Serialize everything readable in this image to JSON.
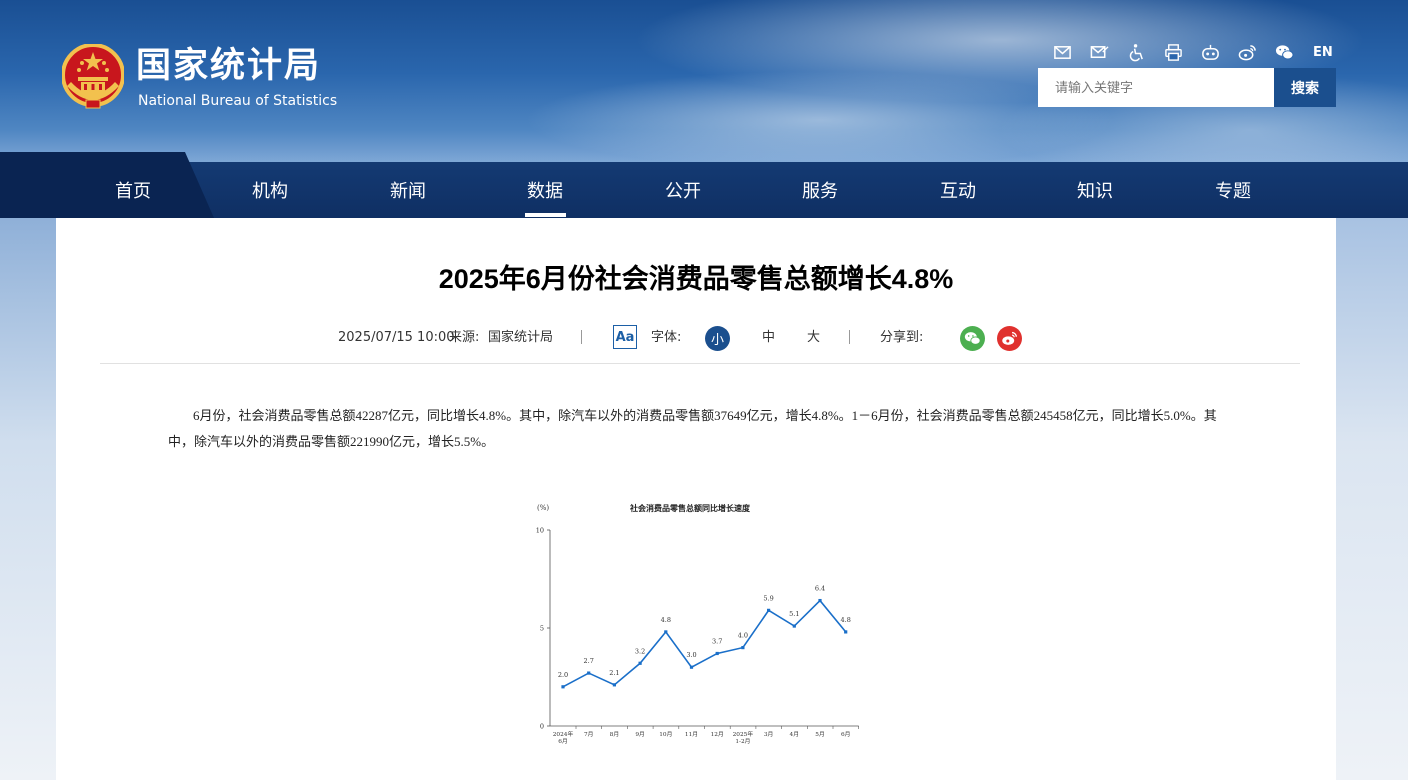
{
  "header": {
    "logo_cn": "国家统计局",
    "logo_en": "National Bureau of Statistics",
    "tool_icons": [
      "mail-icon",
      "mail-edit-icon",
      "accessibility-icon",
      "print-icon",
      "robot-icon",
      "weibo-icon",
      "wechat-icon"
    ],
    "lang": "EN",
    "search": {
      "placeholder": "请输入关键字",
      "button": "搜索"
    }
  },
  "nav": {
    "items": [
      "首页",
      "机构",
      "新闻",
      "数据",
      "公开",
      "服务",
      "互动",
      "知识",
      "专题"
    ],
    "active": "数据"
  },
  "article": {
    "title": "2025年6月份社会消费品零售总额增长4.8%",
    "date": "2025/07/15 10:00",
    "source_label": "来源:",
    "source": "国家统计局",
    "font_icon": "Aa",
    "font_label": "字体:",
    "sizes": [
      "小",
      "中",
      "大"
    ],
    "share_label": "分享到:",
    "body": "6月份，社会消费品零售总额42287亿元，同比增长4.8%。其中，除汽车以外的消费品零售额37649亿元，增长4.8%。1－6月份，社会消费品零售总额245458亿元，同比增长5.0%。其中，除汽车以外的消费品零售额221990亿元，增长5.5%。"
  },
  "colors": {
    "nav_bg": "#0f2f63",
    "accent": "#1b4f8e",
    "line": "#1a6fc9",
    "wechat": "#4caf50",
    "weibo": "#e0312e"
  },
  "chart_data": {
    "type": "line",
    "title": "社会消费品零售总额同比增长速度",
    "ylabel": "(%)",
    "ylim": [
      0,
      10
    ],
    "yticks": [
      "0",
      "5",
      "10"
    ],
    "categories": [
      "2024年6月",
      "7月",
      "8月",
      "9月",
      "10月",
      "11月",
      "12月",
      "2025年1-2月",
      "3月",
      "4月",
      "5月",
      "6月"
    ],
    "x_tick_lines": [
      [
        "2024年",
        "6月"
      ],
      [
        "7月"
      ],
      [
        "8月"
      ],
      [
        "9月"
      ],
      [
        "10月"
      ],
      [
        "11月"
      ],
      [
        "12月"
      ],
      [
        "2025年",
        "1-2月"
      ],
      [
        "3月"
      ],
      [
        "4月"
      ],
      [
        "5月"
      ],
      [
        "6月"
      ]
    ],
    "values": [
      2.0,
      2.7,
      2.1,
      3.2,
      4.8,
      3.0,
      3.7,
      4.0,
      5.9,
      5.1,
      6.4,
      4.8
    ],
    "data_labels": [
      "2.0",
      "2.7",
      "2.1",
      "3.2",
      "4.8",
      "3.0",
      "3.7",
      "4.0",
      "5.9",
      "5.1",
      "6.4",
      "4.8"
    ]
  }
}
